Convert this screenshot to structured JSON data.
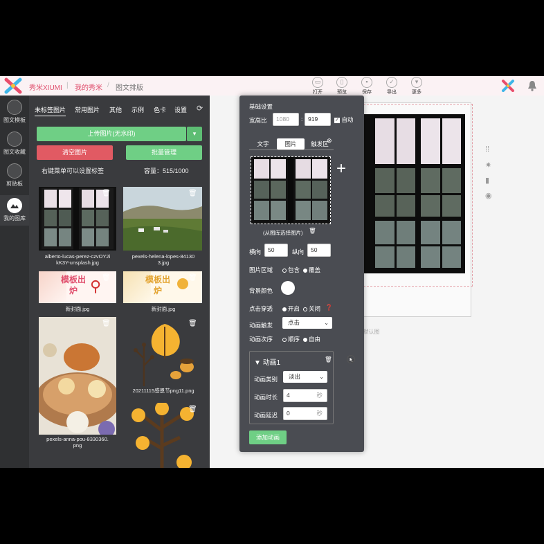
{
  "topbar": {
    "brand": "秀米XIUMI",
    "crumbs": [
      "我的秀米",
      "图文排版"
    ],
    "tools": [
      {
        "icon": "folder-icon",
        "label": "打开"
      },
      {
        "icon": "preview-icon",
        "label": "预览"
      },
      {
        "icon": "save-icon",
        "label": "保存"
      },
      {
        "icon": "export-icon",
        "label": "导出"
      },
      {
        "icon": "more-icon",
        "label": "更多"
      }
    ]
  },
  "nav": [
    {
      "icon": "template-icon",
      "label": "图文模板"
    },
    {
      "icon": "collection-icon",
      "label": "图文收藏"
    },
    {
      "icon": "clipboard-icon",
      "label": "剪贴板"
    },
    {
      "icon": "gallery-icon",
      "label": "我的图库"
    }
  ],
  "gallery": {
    "tabs": [
      "未标签图片",
      "常用图片",
      "其他",
      "示例",
      "色卡",
      "设置"
    ],
    "upload_label": "上传图片(无水印)",
    "clear_label": "清空图片",
    "batch_label": "批量管理",
    "hint": "右键菜单可以设置标签",
    "capacity": "容量：515/1000",
    "items": [
      {
        "caption_line1": "alberto-lucas-perez-czvOY2i",
        "caption_line2": "kK3Y-unsplash.jpg"
      },
      {
        "caption_line1": "pexels-helena-lopes-84130",
        "caption_line2": "3.jpg"
      },
      {
        "caption_line1": "新封面.jpg",
        "caption_line2": "",
        "banner": "模板出炉"
      },
      {
        "caption_line1": "新封面.jpg",
        "caption_line2": "",
        "banner": "模板出炉"
      },
      {
        "caption_line1": "pexels-anna-pou-8330360.",
        "caption_line2": "png"
      },
      {
        "caption_line1": "20211115感恩节png11.png",
        "caption_line2": ""
      }
    ]
  },
  "canvas": {
    "faint_text": "0，默认图"
  },
  "popup": {
    "section_title": "基础设置",
    "aspect_label": "宽高比",
    "aspect_w": "1080",
    "aspect_h": "919",
    "auto_label": "自动",
    "tabs": [
      "文字",
      "图片",
      "触发区"
    ],
    "choose_image": "(从图库选择图片)",
    "h_label": "横向",
    "h_value": "50",
    "v_label": "纵向",
    "v_value": "50",
    "area_label": "图片区域",
    "area_opt1": "包含",
    "area_opt2": "覆盖",
    "bg_label": "背景颜色",
    "pass_label": "点击穿透",
    "pass_on": "开启",
    "pass_off": "关闭",
    "trigger_label": "动画触发",
    "trigger_value": "点击",
    "order_label": "动画次序",
    "order_opt1": "顺序",
    "order_opt2": "自由",
    "anim_title": "动画1",
    "anim_type_label": "动画类别",
    "anim_type_value": "淡出",
    "anim_duration_label": "动画时长",
    "anim_duration_value": "4",
    "anim_delay_label": "动画延迟",
    "anim_delay_value": "0",
    "unit_sec": "秒",
    "add_anim": "添加动画"
  },
  "colors": {
    "accent_green": "#6fcf85",
    "accent_red": "#e15a63",
    "brand_pink": "#e0506e"
  }
}
